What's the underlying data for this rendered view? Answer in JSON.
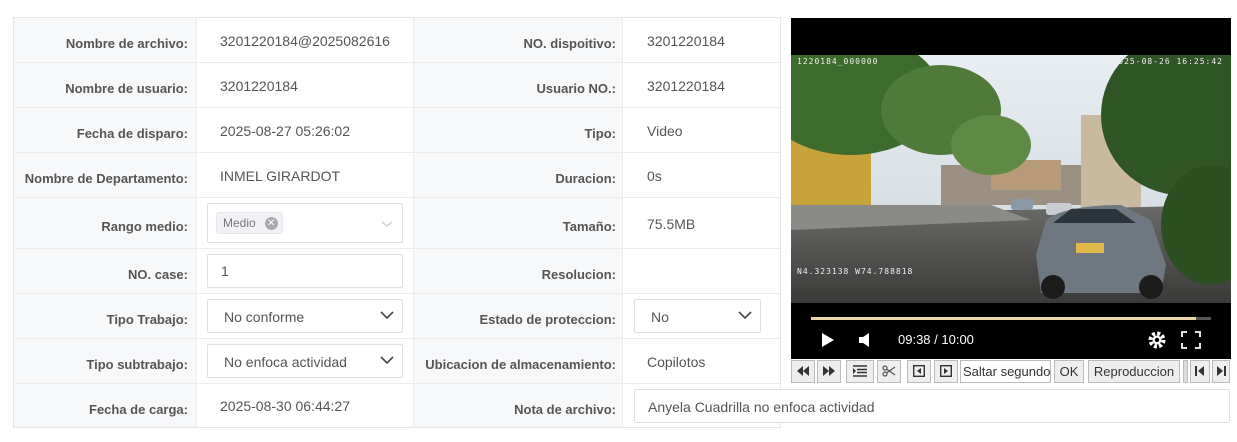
{
  "fields": {
    "nombre_archivo": {
      "label": "Nombre de archivo:",
      "value": "3201220184@2025082616"
    },
    "nombre_usuario": {
      "label": "Nombre de usuario:",
      "value": "3201220184"
    },
    "fecha_disparo": {
      "label": "Fecha de disparo:",
      "value": "2025-08-27 05:26:02"
    },
    "departamento": {
      "label": "Nombre de Departamento:",
      "value": "INMEL GIRARDOT"
    },
    "rango_medio": {
      "label": "Rango medio:",
      "tag": "Medio"
    },
    "no_case": {
      "label": "NO. case:",
      "value": "1"
    },
    "tipo_trabajo": {
      "label": "Tipo Trabajo:",
      "value": "No conforme"
    },
    "tipo_subtrabajo": {
      "label": "Tipo subtrabajo:",
      "value": "No enfoca actividad"
    },
    "fecha_carga": {
      "label": "Fecha de carga:",
      "value": "2025-08-30 06:44:27"
    },
    "no_dispositivo": {
      "label": "NO. dispoitivo:",
      "value": "3201220184"
    },
    "usuario_no": {
      "label": "Usuario NO.:",
      "value": "3201220184"
    },
    "tipo": {
      "label": "Tipo:",
      "value": "Video"
    },
    "duracion": {
      "label": "Duracion:",
      "value": "0s"
    },
    "tamano": {
      "label": "Tamaño:",
      "value": "75.5MB"
    },
    "resolucion": {
      "label": "Resolucion:",
      "value": ""
    },
    "estado_proteccion": {
      "label": "Estado de proteccion:",
      "value": "No"
    },
    "ubicacion": {
      "label": "Ubicacion de almacenamiento:",
      "value": "Copilotos"
    },
    "nota_archivo": {
      "label": "Nota de archivo:",
      "value": "Anyela Cuadrilla no enfoca actividad"
    }
  },
  "video": {
    "overlay_id": "1220184_000000",
    "overlay_datetime": "2025-08-26 16:25:42",
    "overlay_gps": "N4.323138 W74.788818",
    "time": "09:38 / 10:00",
    "progress": 0.963
  },
  "toolbar": {
    "seek_placeholder": "Saltar segundos",
    "ok_label": "OK",
    "play_label": "Reproduccion"
  }
}
